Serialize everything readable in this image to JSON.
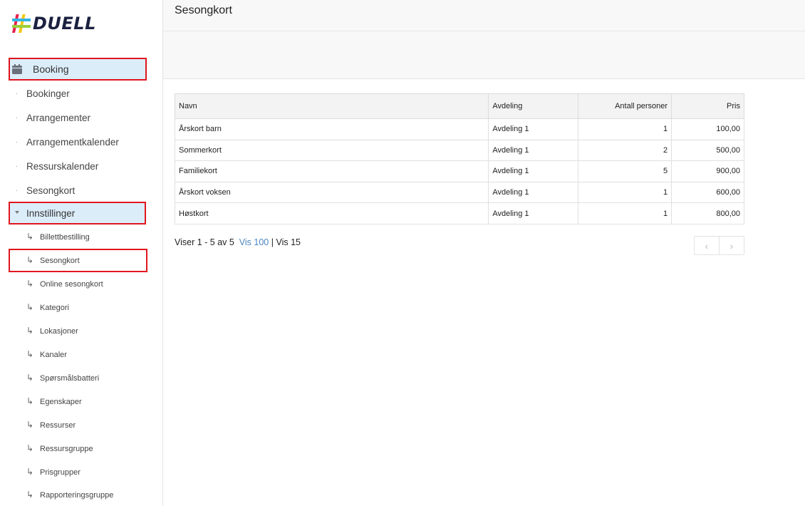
{
  "brand": {
    "name": "DUELL"
  },
  "sidebar": {
    "booking_label": "Booking",
    "items": [
      {
        "label": "Bookinger"
      },
      {
        "label": "Arrangementer"
      },
      {
        "label": "Arrangementkalender"
      },
      {
        "label": "Ressurskalender"
      },
      {
        "label": "Sesongkort"
      }
    ],
    "settings_label": "Innstillinger",
    "sub_items": [
      {
        "label": "Billettbestilling"
      },
      {
        "label": "Sesongkort"
      },
      {
        "label": "Online sesongkort"
      },
      {
        "label": "Kategori"
      },
      {
        "label": "Lokasjoner"
      },
      {
        "label": "Kanaler"
      },
      {
        "label": "Spørsmålsbatteri"
      },
      {
        "label": "Egenskaper"
      },
      {
        "label": "Ressurser"
      },
      {
        "label": "Ressursgruppe"
      },
      {
        "label": "Prisgrupper"
      },
      {
        "label": "Rapporteringsgruppe"
      }
    ],
    "sub_arrow": "↳"
  },
  "header": {
    "title": "Sesongkort"
  },
  "table": {
    "columns": [
      "Navn",
      "Avdeling",
      "Antall personer",
      "Pris"
    ],
    "rows": [
      {
        "navn": "Årskort barn",
        "avdeling": "Avdeling 1",
        "antall": "1",
        "pris": "100,00"
      },
      {
        "navn": "Sommerkort",
        "avdeling": "Avdeling 1",
        "antall": "2",
        "pris": "500,00"
      },
      {
        "navn": "Familiekort",
        "avdeling": "Avdeling 1",
        "antall": "5",
        "pris": "900,00"
      },
      {
        "navn": "Årskort voksen",
        "avdeling": "Avdeling 1",
        "antall": "1",
        "pris": "600,00"
      },
      {
        "navn": "Høstkort",
        "avdeling": "Avdeling 1",
        "antall": "1",
        "pris": "800,00"
      }
    ]
  },
  "pager": {
    "summary": "Viser 1 - 5 av 5",
    "vis100": "Vis 100",
    "separator": "|",
    "vis15": "Vis 15",
    "prev_icon": "‹",
    "next_icon": "›"
  },
  "colors": {
    "highlight_border": "#e0161e",
    "highlight_bg": "#dcedfa",
    "link": "#4a86c0"
  },
  "icons": {
    "booking": "calendar-icon",
    "prev": "chevron-left-icon",
    "next": "chevron-right-icon"
  }
}
